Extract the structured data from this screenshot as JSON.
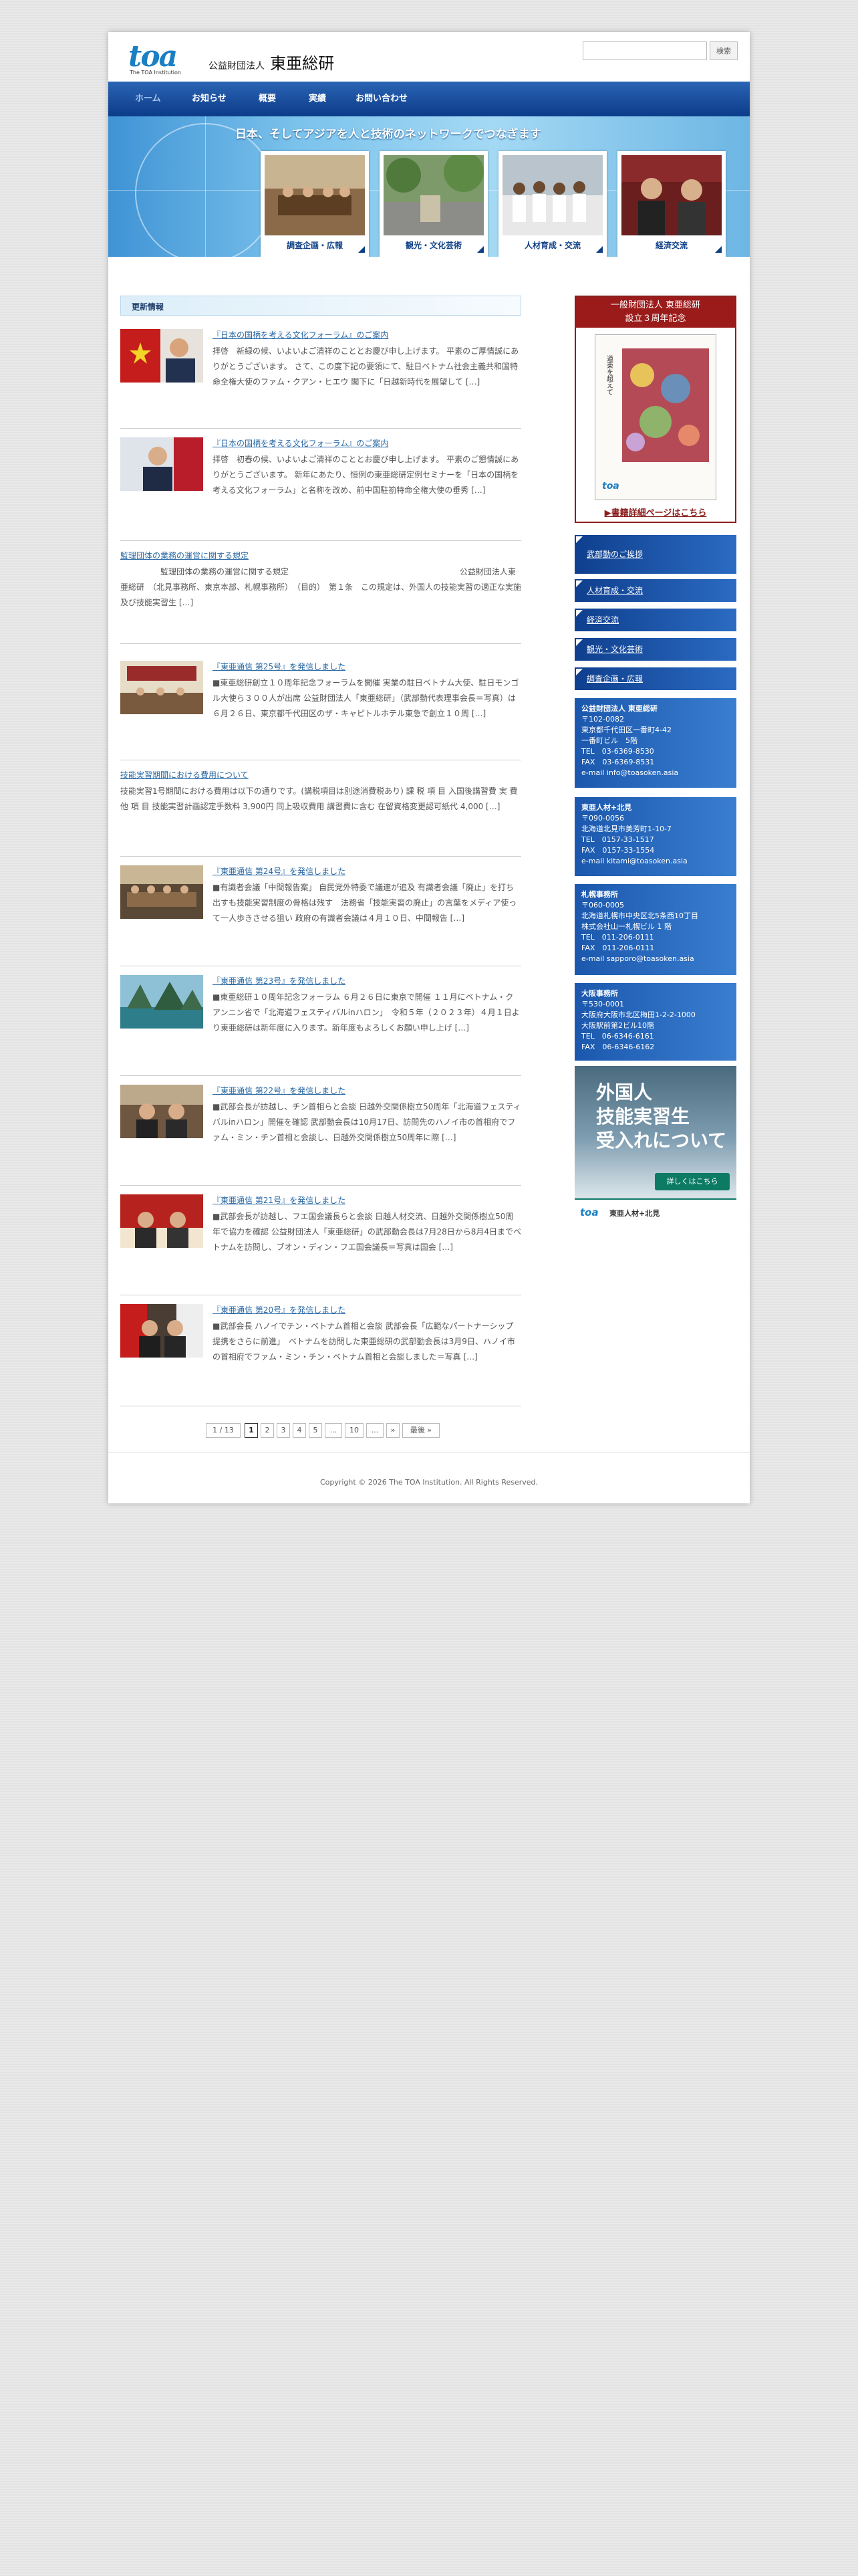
{
  "header": {
    "logo_text": "toa",
    "logo_sub": "The TOA Institution",
    "org_prefix": "公益財団法人",
    "org_name": "東亜総研",
    "search_placeholder": "",
    "search_button": "検索"
  },
  "nav": [
    "ホーム",
    "お知らせ",
    "概要",
    "実績",
    "お問い合わせ"
  ],
  "banner": {
    "title": "日本、そしてアジアを人と技術のネットワークでつなぎます",
    "tiles": [
      "調査企画・広報",
      "観光・文化芸術",
      "人材育成・交流",
      "経済交流"
    ]
  },
  "main": {
    "heading": "更新情報",
    "posts": [
      {
        "title": "『日本の国柄を考える文化フォーラム』のご案内",
        "body": "拝啓　新緑の候、いよいよご清祥のこととお慶び申し上げます。 平素のご厚情誠にありがとうございます。 さて、この度下記の要領にて、駐日ベトナム社会主義共和国特命全権大使のファム・クアン・ヒエウ 閣下に「日越新時代を展望して […]"
      },
      {
        "title": "『日本の国柄を考える文化フォーラム』のご案内",
        "body": "拝啓　初春の候、いよいよご清祥のこととお慶び申し上げます。 平素のご懇情誠にありがとうございます。 新年にあたり、恒例の東亜総研定例セミナーを「日本の国柄を考える文化フォーラム」と名称を改め、前中国駐箚特命全権大使の垂秀 […]"
      },
      {
        "title": "監理団体の業務の運営に関する規定",
        "body": "　　　　　監理団体の業務の運営に関する規定 　　　　　　　　　　　　　　　　　　　　　公益財団法人東亜総研　（北見事務所、東京本部、札幌事務所）　（目的）　第１条　この規定は、外国人の技能実習の適正な実施及び技能実習生 […]"
      },
      {
        "title": "『東亜通信 第25号』を発信しました",
        "body": "■東亜総研創立１０周年記念フォーラムを開催 実業の駐日ベトナム大使、駐日モンゴル大使ら３００人が出席 公益財団法人「東亜総研」（武部勤代表理事会長＝写真）は６月２６日、東京都千代田区のザ・キャピトルホテル東急で創立１０周 […]"
      },
      {
        "title": "技能実習期間における費用について",
        "body": "技能実習1号期間における費用は以下の通りです。(講税項目は別途消費税あり) 課 税 項 目 入国後講習費 実 費 他 項 目 技能実習計画認定手数料 3,900円 同上吸収費用 講習費に含む 在留資格変更認可紙代 4,000 […]"
      },
      {
        "title": "『東亜通信 第24号』を発信しました",
        "body": "■有識者会議「中間報告案」 自民党外特委で議連が追及 有識者会議「廃止」を打ち出すも技能実習制度の骨格は残す　法務省「技能実習の廃止」の言葉をメディア使って一人歩きさせる狙い 政府の有識者会議は４月１０日、中間報告 […]"
      },
      {
        "title": "『東亜通信 第23号』を発信しました",
        "body": "■東亜総研１０周年記念フォーラム ６月２６日に東京で開催 １１月にベトナム・クアンニン省で「北海道フェスティバルinハロン」　令和５年（２０２３年）４月１日より東亜総研は新年度に入ります。新年度もよろしくお願い申し上げ […]"
      },
      {
        "title": "『東亜通信 第22号』を発信しました",
        "body": "■武部会長が訪越し、チン首相らと会談 日越外交関係樹立50周年「北海道フェスティバルinハロン」開催を確認 武部勤会長は10月17日、訪問先のハノイ市の首相府でファム・ミン・チン首相と会談し、日越外交関係樹立50周年に際 […]"
      },
      {
        "title": "『東亜通信 第21号』を発信しました",
        "body": "■武部会長が訪越し、フエ国会議長らと会談 日越人材交流、日越外交関係樹立50周年で協力を確認 公益財団法人「東亜総研」の武部勤会長は7月28日から8月4日までベトナムを訪問し、ブオン・ディン・フエ国会議長＝写真は国会 […]"
      },
      {
        "title": "『東亜通信 第20号』を発信しました",
        "body": "■武部会長 ハノイでチン・ベトナム首相と会談 武部会長「広範なパートナーシップ提携をさらに前進」　ベトナムを訪問した東亜総研の武部勤会長は3月9日、ハノイ市の首相府でファム・ミン・チン・ベトナム首相と会談しました＝写真 […]"
      }
    ]
  },
  "pager": [
    "1 / 13",
    "1",
    "2",
    "3",
    "4",
    "5",
    "...",
    "10",
    "...",
    "»",
    "最後 »"
  ],
  "footer": "Copyright © 2026 The TOA Institution. All Rights Reserved.",
  "sidebar": {
    "banner_top": "一般財団法人 東亜総研",
    "banner_top2": "設立３周年記念",
    "book_title": "道東を超えて",
    "book_logo": "toa",
    "banner_link": "▶書籍詳細ページはこちら",
    "buttons": [
      "武部勤のご挨拶",
      "人材育成・交流",
      "経済交流",
      "観光・文化芸術",
      "調査企画・広報"
    ],
    "offices": [
      {
        "name": "公益財団法人 東亜総研",
        "lines": [
          "〒102-0082",
          "東京都千代田区一番町4-42",
          "一番町ビル　5階",
          "TEL　03-6369-8530",
          "FAX　03-6369-8531",
          "e-mail info@toasoken.asia"
        ]
      },
      {
        "name": "東亜人材+北見",
        "lines": [
          "〒090-0056",
          "北海道北見市美芳町1-10-7",
          "TEL　0157-33-1517",
          "FAX　0157-33-1554",
          "e-mail kitami@toasoken.asia"
        ]
      },
      {
        "name": "札幌事務所",
        "lines": [
          "〒060-0005",
          "北海道札幌市中央区北5条西10丁目",
          "株式会社山一札幌ビル 1 階",
          "TEL　011-206-0111",
          "FAX　011-206-0111",
          "e-mail sapporo@toasoken.asia"
        ]
      },
      {
        "name": "大阪事務所",
        "lines": [
          "〒530-0001",
          "大阪府大阪市北区梅田1-2-2-1000",
          "大阪駅前第2ビル10階",
          "TEL　06-6346-6161",
          "FAX　06-6346-6162"
        ]
      }
    ],
    "ad": {
      "line1": "外国人",
      "line2": "技能実習生",
      "line3": "受入れについて",
      "more": "詳しくはこちら",
      "foot_logo": "toa",
      "foot_text": "東亜人材+北見"
    }
  },
  "colors": {
    "nav": "#0c3c8a",
    "link": "#2a6aa5",
    "accent": "#9b1b1b"
  }
}
